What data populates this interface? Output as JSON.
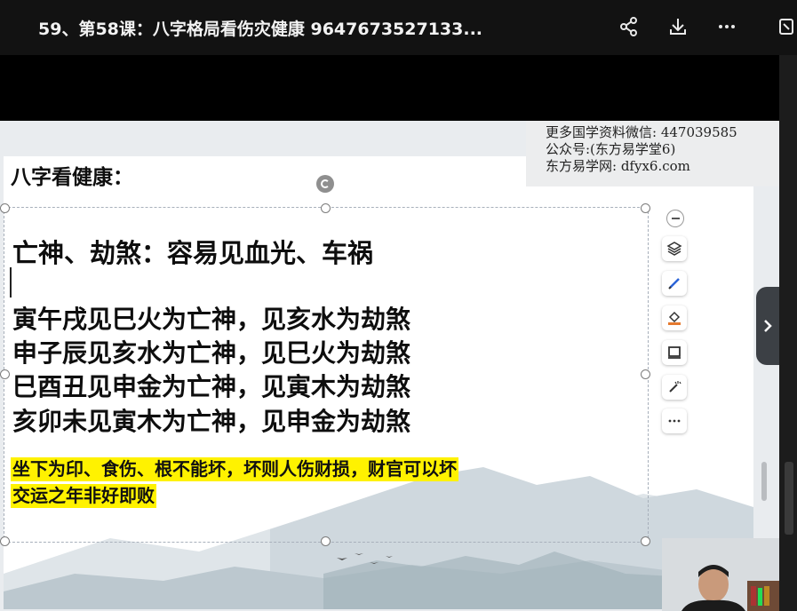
{
  "window": {
    "title": "59、第58课：八字格局看伤灾健康 9647673527133..."
  },
  "toolbar": {
    "share_icon": "share-icon",
    "download_icon": "download-icon",
    "more_icon": "more-icon",
    "exit_icon": "exit-icon"
  },
  "watermark": {
    "line1": "更多国学资料微信: 447039585",
    "line2": "公众号:(东方易学堂6)",
    "line3": "东方易学网: dfyx6.com"
  },
  "slide": {
    "heading": "八字看健康：",
    "subheading": "亡神、劫煞：容易见血光、车祸",
    "rules": [
      "寅午戌见巳火为亡神，见亥水为劫煞",
      "申子辰见亥水为亡神，见巳火为劫煞",
      "巳酉丑见申金为亡神，见寅木为劫煞",
      "亥卯未见寅木为亡神，见申金为劫煞"
    ],
    "highlight_line1": "坐下为印、食伤、根不能坏，坏则人伤财损，财官可以坏",
    "highlight_line2": "交运之年非好即败"
  },
  "side_tools": [
    "minus-icon",
    "layers-icon",
    "pen-icon",
    "paint-bucket-icon",
    "presentation-icon",
    "magic-wand-icon",
    "more-horizontal-icon"
  ],
  "colors": {
    "highlight": "#fff200",
    "title_bar": "#121212",
    "slide_bg": "#ffffff"
  }
}
